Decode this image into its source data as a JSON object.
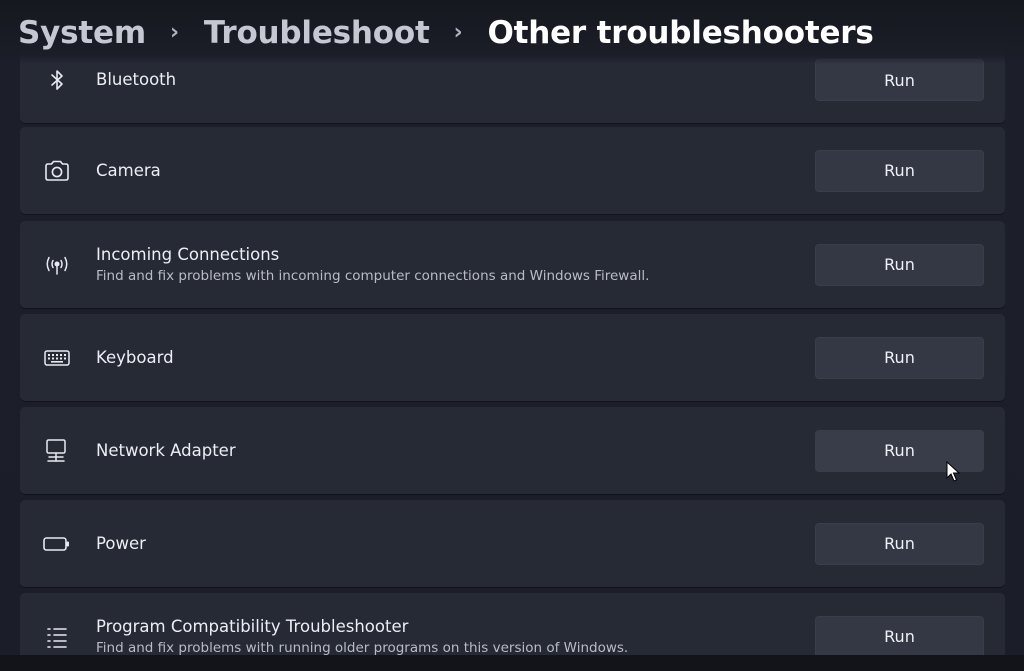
{
  "breadcrumb": {
    "root": "System",
    "middle": "Troubleshoot",
    "current": "Other troubleshooters",
    "separator": "›"
  },
  "troubleshooters": [
    {
      "title": "Bluetooth",
      "description": "",
      "icon": "bluetooth-icon",
      "button": "Run"
    },
    {
      "title": "Camera",
      "description": "",
      "icon": "camera-icon",
      "button": "Run"
    },
    {
      "title": "Incoming Connections",
      "description": "Find and fix problems with incoming computer connections and Windows Firewall.",
      "icon": "antenna-icon",
      "button": "Run"
    },
    {
      "title": "Keyboard",
      "description": "",
      "icon": "keyboard-icon",
      "button": "Run"
    },
    {
      "title": "Network Adapter",
      "description": "",
      "icon": "network-adapter-icon",
      "button": "Run"
    },
    {
      "title": "Power",
      "description": "",
      "icon": "battery-icon",
      "button": "Run"
    },
    {
      "title": "Program Compatibility Troubleshooter",
      "description": "Find and fix problems with running older programs on this version of Windows.",
      "icon": "list-icon",
      "button": "Run"
    }
  ],
  "colors": {
    "background": "#1a1d26",
    "card": "#262a35",
    "button": "#343845",
    "text": "#eceef3"
  }
}
